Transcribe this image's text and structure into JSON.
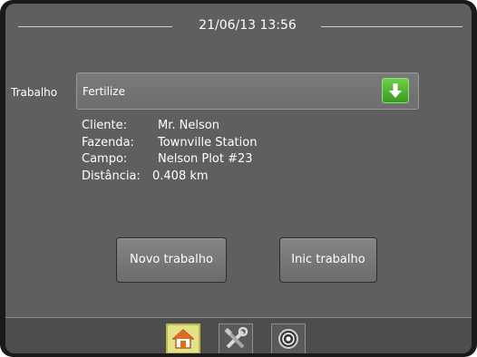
{
  "header": {
    "datetime": "21/06/13 13:56"
  },
  "job": {
    "label": "Trabalho",
    "value": "Fertilize",
    "dropdown_icon": "green-down-arrow-icon"
  },
  "details": {
    "client_label": "Cliente:",
    "client_value": "Mr. Nelson",
    "farm_label": "Fazenda:",
    "farm_value": "Townville Station",
    "field_label": "Campo:",
    "field_value": "Nelson Plot #23",
    "distance_label": "Distância:",
    "distance_value": "0.408 km"
  },
  "buttons": {
    "new_job": "Novo trabalho",
    "start_job": "Inic trabalho"
  },
  "bottom_tabs": [
    {
      "icon": "home-icon",
      "active": true
    },
    {
      "icon": "tools-icon",
      "active": false
    },
    {
      "icon": "gps-icon",
      "active": false
    }
  ],
  "colors": {
    "background": "#5f5f5f",
    "accent_green": "#4cb82f",
    "active_tab": "#e2e28a"
  }
}
